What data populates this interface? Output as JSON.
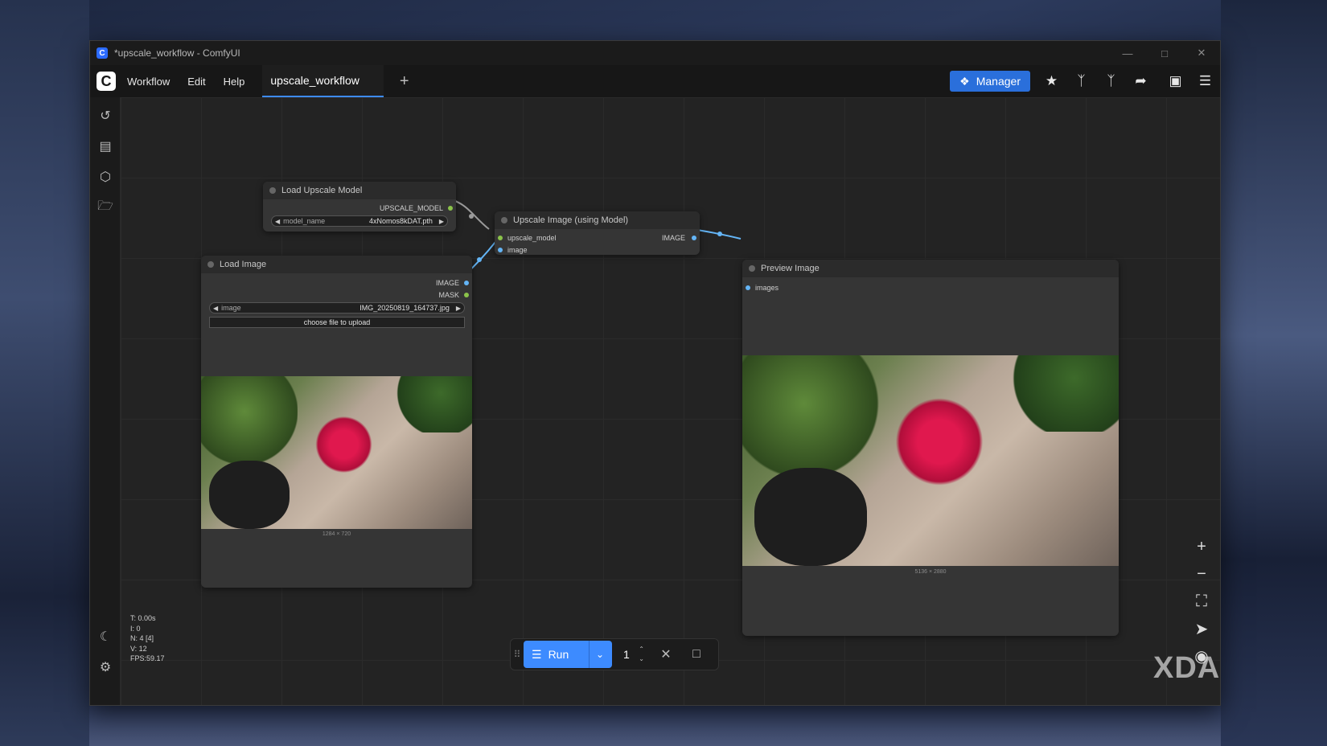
{
  "window": {
    "title": "*upscale_workflow - ComfyUI",
    "app_icon_letter": "C"
  },
  "menubar": {
    "logo_letter": "C",
    "menu": [
      "Workflow",
      "Edit",
      "Help"
    ],
    "active_tab": "upscale_workflow",
    "new_tab": "+"
  },
  "toolbar": {
    "manager_label": "Manager",
    "icons": [
      "star-icon",
      "node-library-icon",
      "model-library-icon",
      "share-icon",
      "panel-toggle-icon",
      "hamburger-menu-icon"
    ]
  },
  "sidebar": {
    "icons": [
      "history-icon",
      "queue-icon",
      "model-box-icon",
      "folder-icon"
    ],
    "bottom_icons": [
      "theme-moon-icon",
      "settings-gear-icon"
    ]
  },
  "nodes": {
    "load_upscale_model": {
      "title": "Load Upscale Model",
      "output": "UPSCALE_MODEL",
      "widget_name": "model_name",
      "widget_value": "4xNomos8kDAT.pth"
    },
    "upscale_image": {
      "title": "Upscale Image (using Model)",
      "input_1": "upscale_model",
      "input_2": "image",
      "output": "IMAGE"
    },
    "load_image": {
      "title": "Load Image",
      "output_1": "IMAGE",
      "output_2": "MASK",
      "widget_name": "image",
      "widget_value": "IMG_20250819_164737.jpg",
      "upload_label": "choose file to upload",
      "image_size": "1284 × 720"
    },
    "preview_image": {
      "title": "Preview Image",
      "input": "images",
      "image_size": "5136 × 2880"
    }
  },
  "stats": {
    "t": "T: 0.00s",
    "i": "I: 0",
    "n": "N: 4 [4]",
    "v": "V: 12",
    "fps": "FPS:59.17"
  },
  "run_bar": {
    "run_label": "Run",
    "batch_count": "1"
  },
  "colors": {
    "accent": "#3d8bff",
    "manager": "#2a6fdb",
    "image_slot": "#64b5f6",
    "model_slot": "#8bc34a"
  },
  "watermark": "XDA"
}
